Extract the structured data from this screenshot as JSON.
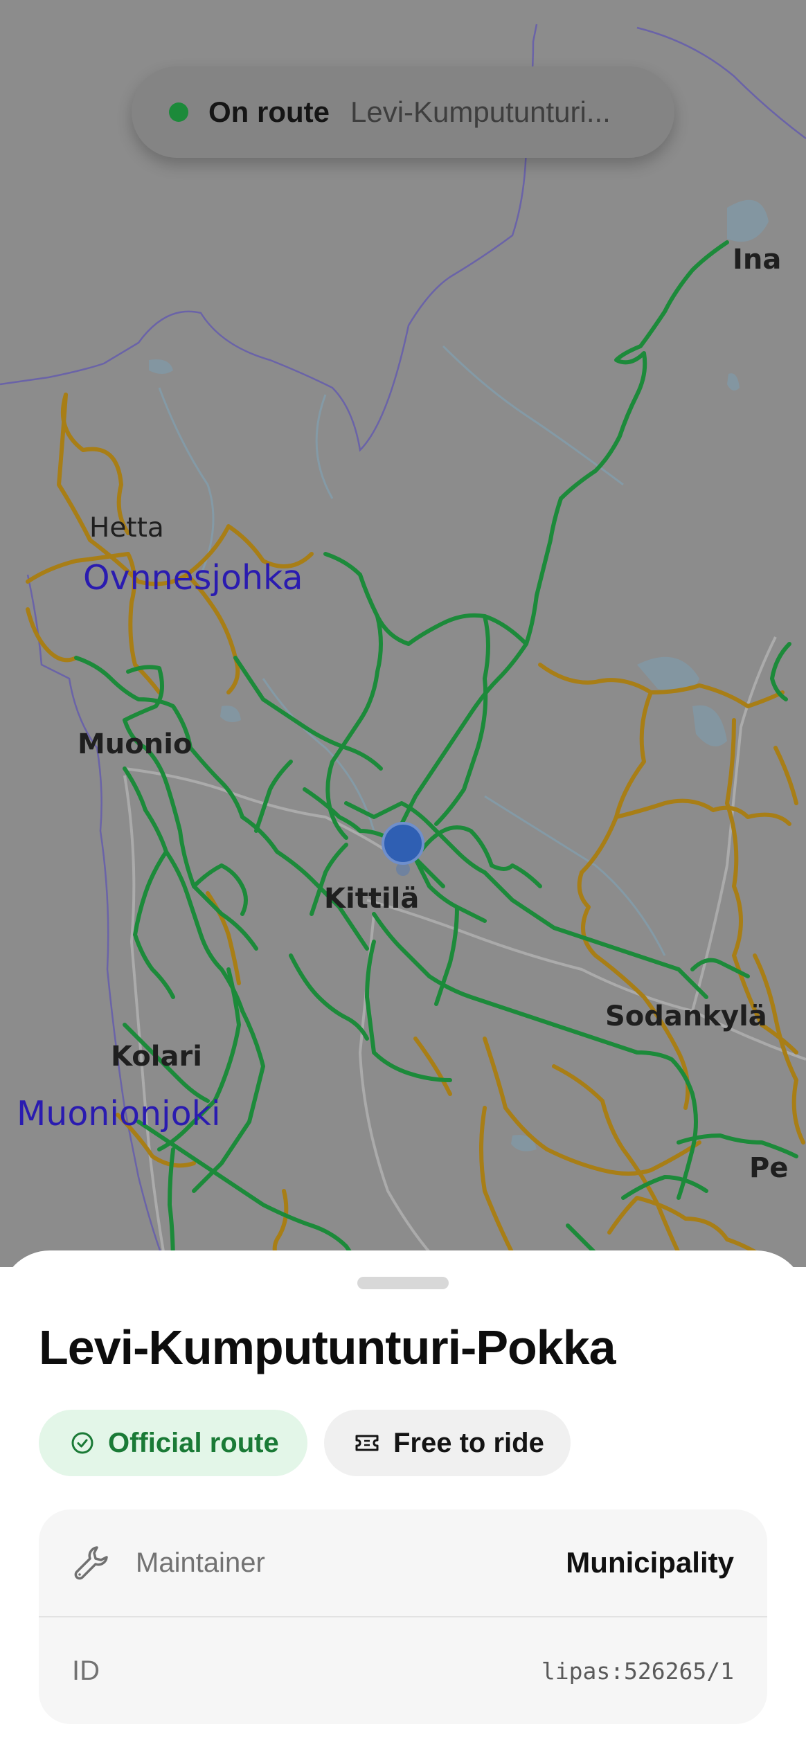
{
  "status_bar": {
    "status_label": "On route",
    "route_name": "Levi-Kumputunturi...",
    "status_color": "#1c8a3a"
  },
  "map": {
    "places": {
      "hetta": "Hetta",
      "muonio": "Muonio",
      "kittila": "Kittilä",
      "kolari": "Kolari",
      "sodankyla": "Sodankylä",
      "inari": "Ina",
      "pelkosenniemi": "Pe"
    },
    "waters": {
      "ovnnesjohka": "Ovnnesjohka",
      "muonionjoki": "Muonionjoki"
    },
    "colors": {
      "official_trail": "#1c8a3a",
      "other_trail": "#a87e16",
      "location_marker": "#2f5fb3",
      "border": "#6a63a8",
      "water": "#7aa0b8"
    }
  },
  "sheet": {
    "title": "Levi-Kumputunturi-Pokka",
    "badges": {
      "official": {
        "label": "Official route",
        "icon": "check-circle-icon"
      },
      "free": {
        "label": "Free to ride",
        "icon": "ticket-icon"
      }
    },
    "details": {
      "maintainer": {
        "label": "Maintainer",
        "value": "Municipality",
        "icon": "wrench-icon"
      },
      "id": {
        "label": "ID",
        "value": "lipas:526265/1"
      }
    }
  }
}
